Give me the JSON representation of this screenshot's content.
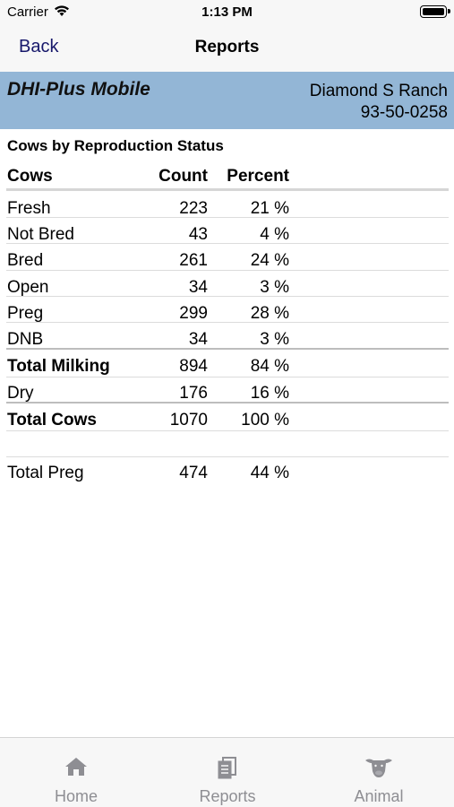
{
  "status": {
    "carrier": "Carrier",
    "time": "1:13 PM"
  },
  "nav": {
    "back_label": "Back",
    "title": "Reports"
  },
  "banner": {
    "app_name": "DHI-Plus Mobile",
    "ranch": "Diamond S Ranch",
    "herd_id": "93-50-0258"
  },
  "report": {
    "title": "Cows by Reproduction Status",
    "headers": {
      "cows": "Cows",
      "count": "Count",
      "percent": "Percent"
    },
    "rows": [
      {
        "label": "Fresh",
        "count": "223",
        "percent": "21 %"
      },
      {
        "label": "Not Bred",
        "count": "43",
        "percent": "4 %"
      },
      {
        "label": "Bred",
        "count": "261",
        "percent": "24 %"
      },
      {
        "label": "Open",
        "count": "34",
        "percent": "3 %"
      },
      {
        "label": "Preg",
        "count": "299",
        "percent": "28 %"
      },
      {
        "label": "DNB",
        "count": "34",
        "percent": "3 %"
      },
      {
        "label": "Total Milking",
        "count": "894",
        "percent": "84 %"
      },
      {
        "label": "Dry",
        "count": "176",
        "percent": "16 %"
      },
      {
        "label": "Total Cows",
        "count": "1070",
        "percent": "100 %"
      },
      {
        "label": "Total Preg",
        "count": "474",
        "percent": "44 %"
      }
    ]
  },
  "tabs": [
    {
      "label": "Home",
      "icon": "home-icon"
    },
    {
      "label": "Reports",
      "icon": "reports-icon"
    },
    {
      "label": "Animal",
      "icon": "cow-icon"
    }
  ],
  "colors": {
    "banner": "#93b6d6",
    "nav_back": "#17186b",
    "tab_inactive": "#8e8e93"
  }
}
